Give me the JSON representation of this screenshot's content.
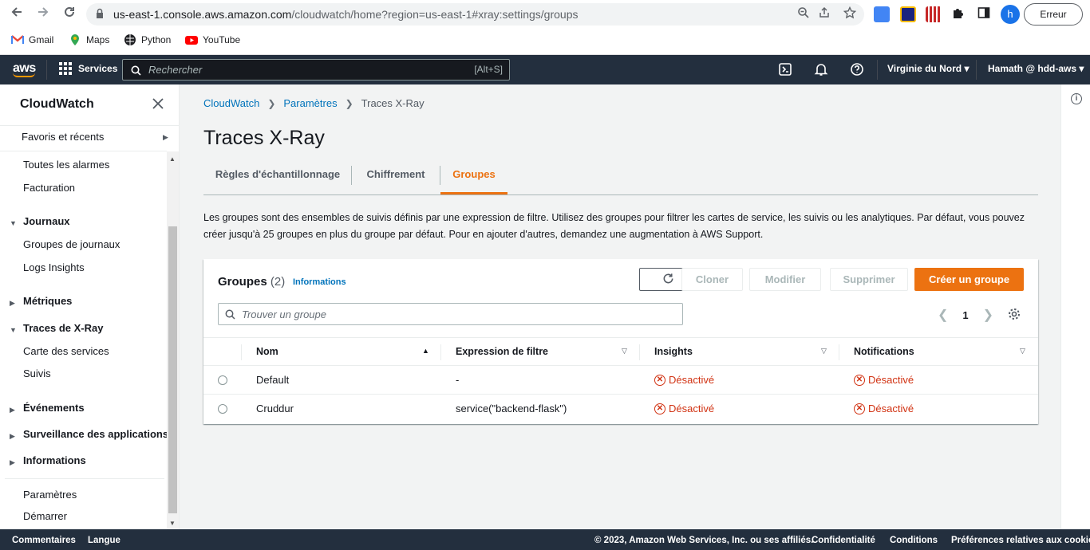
{
  "browser": {
    "url_host": "us-east-1.console.aws.amazon.com",
    "url_path": "/cloudwatch/home?region=us-east-1#xray:settings/groups",
    "profile_initial": "h",
    "error_label": "Erreur",
    "bookmarks": [
      "Gmail",
      "Maps",
      "Python",
      "YouTube"
    ]
  },
  "awsnav": {
    "logo": "aws",
    "services": "Services",
    "search_placeholder": "Rechercher",
    "search_shortcut": "[Alt+S]",
    "region": "Virginie du Nord",
    "account": "Hamath @ hdd-aws"
  },
  "sidebar": {
    "title": "CloudWatch",
    "favorites": "Favoris et récents",
    "items": {
      "alarms": "Toutes les alarmes",
      "billing": "Facturation",
      "logs": "Journaux",
      "log_groups": "Groupes de journaux",
      "logs_insights": "Logs Insights",
      "metrics": "Métriques",
      "xray": "Traces de X-Ray",
      "service_map": "Carte des services",
      "traces": "Suivis",
      "events": "Événements",
      "app_monitoring": "Surveillance des applications",
      "insights": "Informations",
      "settings": "Paramètres",
      "getting_started": "Démarrer"
    }
  },
  "breadcrumb": [
    "CloudWatch",
    "Paramètres",
    "Traces X-Ray"
  ],
  "page_title": "Traces X-Ray",
  "tabs": [
    "Règles d'échantillonnage",
    "Chiffrement",
    "Groupes"
  ],
  "active_tab": "Groupes",
  "description": "Les groupes sont des ensembles de suivis définis par une expression de filtre. Utilisez des groupes pour filtrer les cartes de service, les suivis ou les analytiques. Par défaut, vous pouvez créer jusqu'à 25 groupes en plus du groupe par défaut. Pour en ajouter d'autres, demandez une augmentation à AWS Support.",
  "groups_panel": {
    "title": "Groupes",
    "count": "(2)",
    "info_link": "Informations",
    "buttons": {
      "clone": "Cloner",
      "modify": "Modifier",
      "delete": "Supprimer",
      "create": "Créer un groupe"
    },
    "search_placeholder": "Trouver un groupe",
    "page": "1",
    "columns": [
      "Nom",
      "Expression de filtre",
      "Insights",
      "Notifications"
    ],
    "rows": [
      {
        "name": "Default",
        "filter": "-",
        "insights": "Désactivé",
        "notifications": "Désactivé"
      },
      {
        "name": "Cruddur",
        "filter": "service(\"backend-flask\")",
        "insights": "Désactivé",
        "notifications": "Désactivé"
      }
    ]
  },
  "footer": {
    "feedback": "Commentaires",
    "language": "Langue",
    "copyright": "© 2023, Amazon Web Services, Inc. ou ses affiliés.",
    "privacy": "Confidentialité",
    "terms": "Conditions",
    "cookies": "Préférences relatives aux cookies"
  },
  "colors": {
    "aws_nav": "#232f3e",
    "accent": "#ec7211",
    "link": "#0073bb",
    "error": "#d13212"
  }
}
